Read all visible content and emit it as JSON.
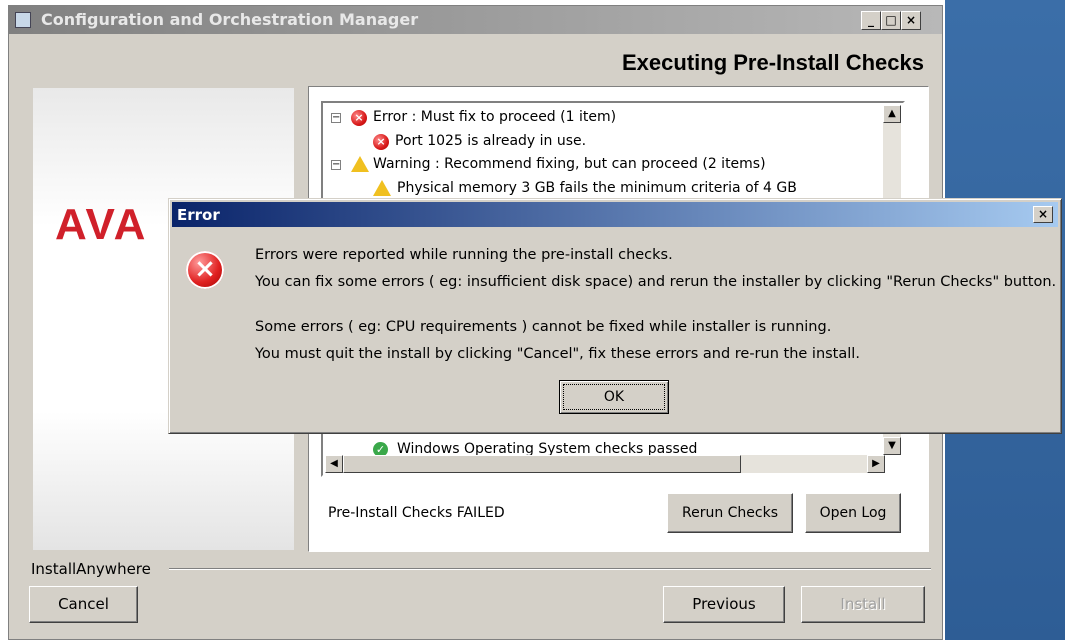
{
  "window": {
    "title": "Configuration and Orchestration Manager",
    "controls": {
      "minimize": "_",
      "maximize": "□",
      "close": "×"
    }
  },
  "header": {
    "title": "Executing Pre-Install Checks"
  },
  "logo": {
    "text": "AVA"
  },
  "tree": {
    "items": [
      {
        "expander": "−",
        "icon": "error-icon",
        "label": "Error : Must fix to proceed (1 item)"
      },
      {
        "icon": "error-icon",
        "label": "Port 1025 is already in use."
      },
      {
        "expander": "−",
        "icon": "warning-icon",
        "label": "Warning : Recommend fixing, but can proceed (2 items)"
      },
      {
        "icon": "warning-icon",
        "label": "Physical memory 3 GB fails the minimum criteria of 4 GB"
      },
      {
        "icon": "check-icon",
        "label": "Windows Operating System checks passed"
      }
    ]
  },
  "status": {
    "text": "Pre-Install Checks FAILED"
  },
  "buttons": {
    "rerun": "Rerun Checks",
    "open_log": "Open Log",
    "cancel": "Cancel",
    "previous": "Previous",
    "install": "Install"
  },
  "footer": {
    "brand": "InstallAnywhere"
  },
  "dialog": {
    "title": "Error",
    "close": "×",
    "lines": [
      "Errors were reported while running the pre-install checks.",
      " You can fix some errors ( eg: insufficient disk space) and rerun the installer by clicking \"Rerun Checks\" button.",
      "Some errors ( eg: CPU requirements ) cannot be fixed while installer is running.",
      " You must quit the install by clicking \"Cancel\", fix these errors and re-run the install."
    ],
    "ok": "OK"
  },
  "colors": {
    "accent": "#0a246a",
    "logo": "#d0202a",
    "desktop": "#3b6ea8"
  }
}
